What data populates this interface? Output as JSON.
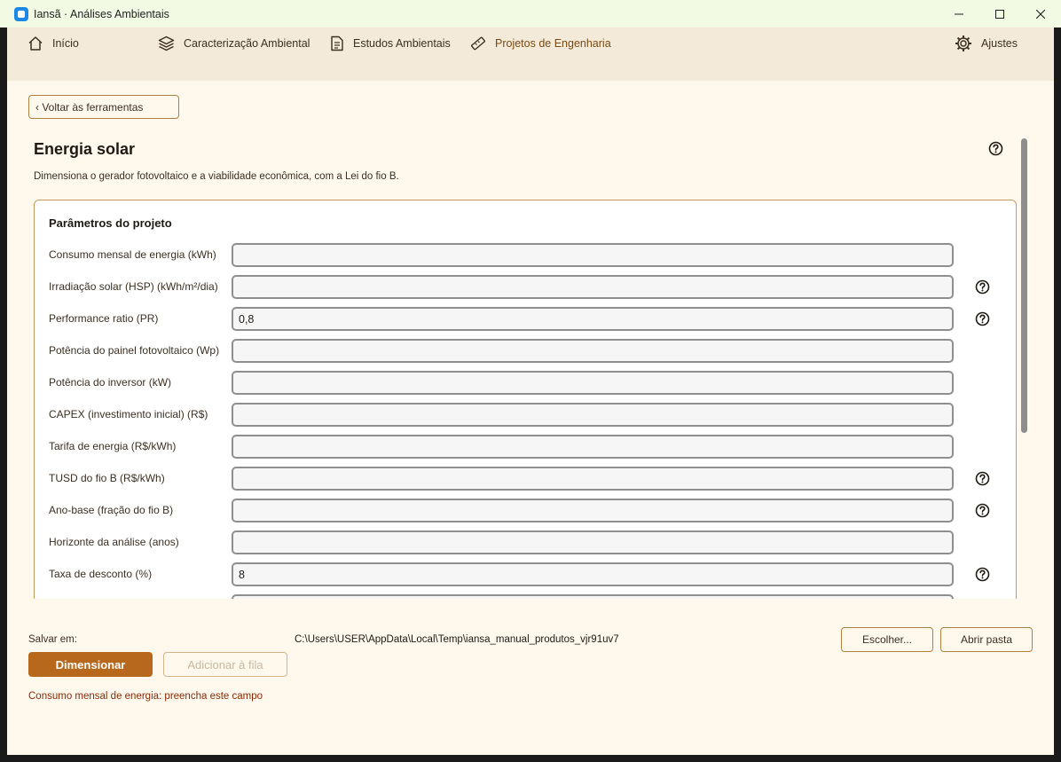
{
  "window": {
    "title": "Iansã · Análises Ambientais"
  },
  "nav": {
    "items": [
      {
        "label": "Início",
        "icon": "home-icon"
      },
      {
        "label": "Caracterização Ambiental",
        "icon": "layers-icon"
      },
      {
        "label": "Estudos Ambientais",
        "icon": "document-icon"
      },
      {
        "label": "Projetos de Engenharia",
        "icon": "ruler-icon"
      }
    ],
    "settings": {
      "label": "Ajustes",
      "icon": "gear-icon"
    }
  },
  "back_button": "‹ Voltar às ferramentas",
  "page": {
    "title": "Energia solar",
    "description": "Dimensiona o gerador fotovoltaico e a viabilidade econômica, com a Lei do fio B."
  },
  "params": {
    "title": "Parâmetros do projeto",
    "rows": [
      {
        "label": "Consumo mensal de energia (kWh)",
        "value": "",
        "help": false
      },
      {
        "label": "Irradiação solar (HSP) (kWh/m²/dia)",
        "value": "",
        "help": true
      },
      {
        "label": "Performance ratio (PR)",
        "value": "0,8",
        "help": true
      },
      {
        "label": "Potência do painel fotovoltaico (Wp)",
        "value": "",
        "help": false
      },
      {
        "label": "Potência do inversor (kW)",
        "value": "",
        "help": false
      },
      {
        "label": "CAPEX (investimento inicial) (R$)",
        "value": "",
        "help": false
      },
      {
        "label": "Tarifa de energia (R$/kWh)",
        "value": "",
        "help": false
      },
      {
        "label": "TUSD do fio B (R$/kWh)",
        "value": "",
        "help": true
      },
      {
        "label": "Ano-base (fração do fio B)",
        "value": "",
        "help": true
      },
      {
        "label": "Horizonte da análise (anos)",
        "value": "",
        "help": false
      },
      {
        "label": "Taxa de desconto (%)",
        "value": "8",
        "help": true
      },
      {
        "label": "",
        "value": "",
        "help": true
      }
    ]
  },
  "footer": {
    "save_label": "Salvar em:",
    "save_path": "C:\\Users\\USER\\AppData\\Local\\Temp\\iansa_manual_produtos_vjr91uv7",
    "choose_button": "Escolher...",
    "open_folder_button": "Abrir pasta",
    "primary_button": "Dimensionar",
    "queue_button": "Adicionar à fila",
    "error": "Consumo mensal de energia: preencha este campo"
  },
  "colors": {
    "accent": "#b8681c",
    "background": "#fff8ec",
    "nav_background": "#f4ead9",
    "error": "#8b2a06"
  }
}
